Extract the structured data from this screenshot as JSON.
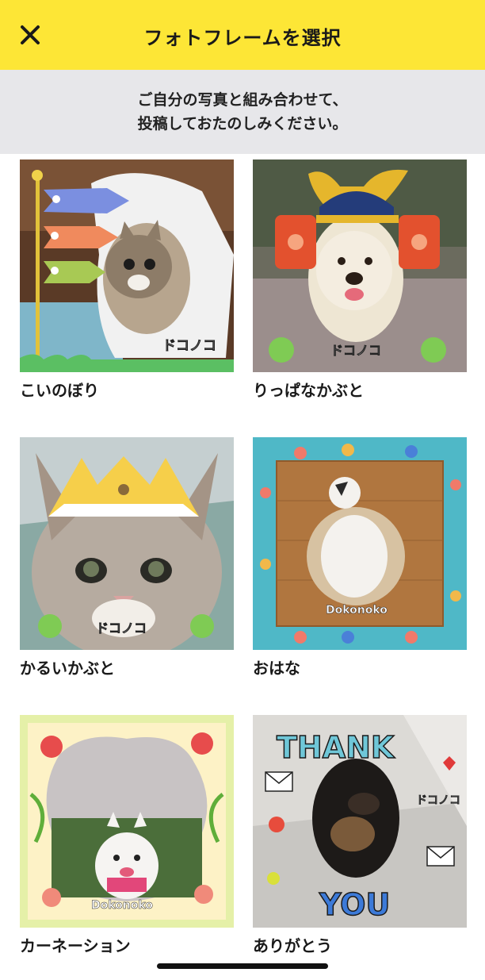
{
  "header": {
    "title": "フォトフレームを選択",
    "close_icon": "close-icon",
    "background": "#fde636"
  },
  "banner": {
    "line1": "ご自分の写真と組み合わせて、",
    "line2": "投稿しておたのしみください。"
  },
  "frames": [
    {
      "label": "こいのぼり",
      "watermark": "ドコノコ"
    },
    {
      "label": "りっぱなかぶと",
      "watermark": "ドコノコ"
    },
    {
      "label": "かるいかぶと",
      "watermark": "ドコノコ"
    },
    {
      "label": "おはな",
      "watermark": "Dokonoko"
    },
    {
      "label": "カーネーション",
      "watermark": "Dokonoko"
    },
    {
      "label": "ありがとう",
      "watermark": "ドコノコ",
      "text_top": "THANK",
      "text_bottom": "YOU"
    }
  ]
}
